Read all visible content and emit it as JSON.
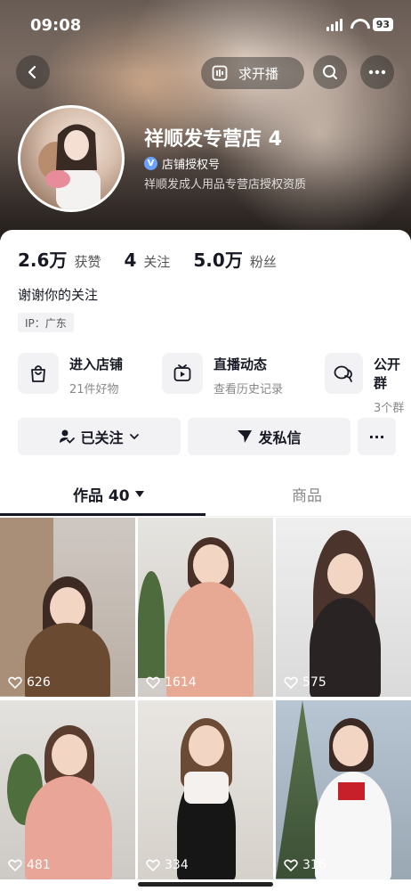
{
  "status_bar": {
    "time": "09:08",
    "battery": "93"
  },
  "header": {
    "live_button_label": "求开播",
    "shop_name": "祥顺发专营店 4",
    "verify_label": "店铺授权号",
    "verify_badge": "V",
    "subtitle": "祥顺发成人用品专营店授权资质"
  },
  "stats": {
    "likes_value": "2.6万",
    "likes_label": "获赞",
    "following_value": "4",
    "following_label": "关注",
    "fans_value": "5.0万",
    "fans_label": "粉丝"
  },
  "bio": "谢谢你的关注",
  "ip": "IP：广东",
  "features": [
    {
      "title": "进入店铺",
      "sub": "21件好物"
    },
    {
      "title": "直播动态",
      "sub": "查看历史记录"
    },
    {
      "title": "公开群",
      "sub": "3个群"
    }
  ],
  "actions": {
    "followed_label": "已关注",
    "message_label": "发私信",
    "more_label": "···"
  },
  "tabs": [
    {
      "label": "作品 40"
    },
    {
      "label": "商品"
    }
  ],
  "posts": [
    {
      "likes": "626"
    },
    {
      "likes": "1614"
    },
    {
      "likes": "575"
    },
    {
      "likes": "481"
    },
    {
      "likes": "334"
    },
    {
      "likes": "316"
    }
  ]
}
